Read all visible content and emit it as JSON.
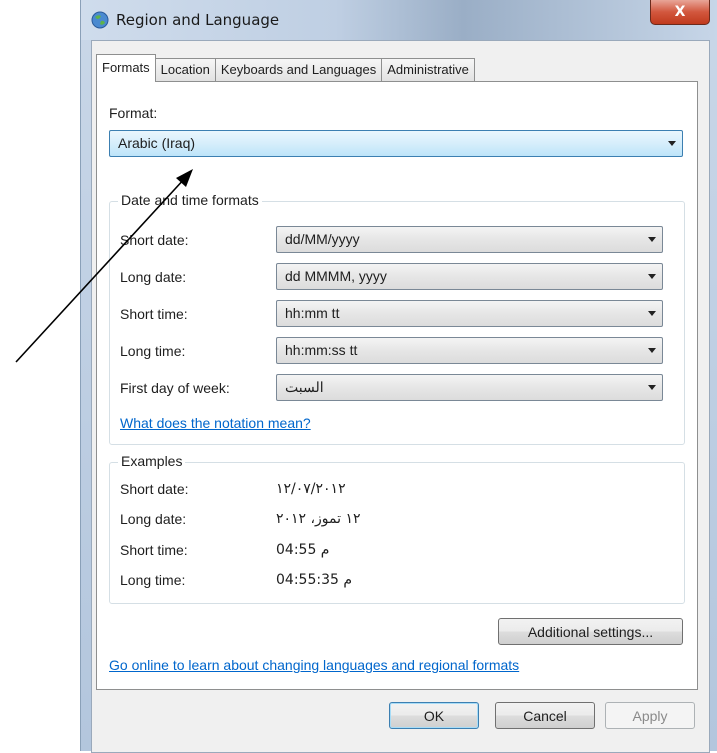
{
  "window": {
    "title": "Region and Language",
    "close_label": "X"
  },
  "tabs": [
    {
      "label": "Formats",
      "active": true
    },
    {
      "label": "Location",
      "active": false
    },
    {
      "label": "Keyboards and Languages",
      "active": false
    },
    {
      "label": "Administrative",
      "active": false
    }
  ],
  "format": {
    "label": "Format:",
    "value": "Arabic (Iraq)"
  },
  "date_time": {
    "group_title": "Date and time formats",
    "rows": [
      {
        "label": "Short date:",
        "value": "dd/MM/yyyy"
      },
      {
        "label": "Long date:",
        "value": "dd MMMM, yyyy"
      },
      {
        "label": "Short time:",
        "value": "hh:mm tt"
      },
      {
        "label": "Long time:",
        "value": "hh:mm:ss tt"
      },
      {
        "label": "First day of week:",
        "value": "السبت"
      }
    ],
    "notation_link": "What does the notation mean?"
  },
  "examples": {
    "group_title": "Examples",
    "rows": [
      {
        "label": "Short date:",
        "value": "١٢/٠٧/٢٠١٢"
      },
      {
        "label": "Long date:",
        "value": "١٢ تموز، ٢٠١٢"
      },
      {
        "label": "Short time:",
        "value": "04:55 م"
      },
      {
        "label": "Long time:",
        "value": "04:55:35 م"
      }
    ]
  },
  "additional_settings_label": "Additional settings...",
  "online_link": "Go online to learn about changing languages and regional formats",
  "buttons": {
    "ok": "OK",
    "cancel": "Cancel",
    "apply": "Apply"
  },
  "colors": {
    "link": "#0066cc",
    "focus_border": "#3c7fb1",
    "close_button": "#c03a1d"
  }
}
